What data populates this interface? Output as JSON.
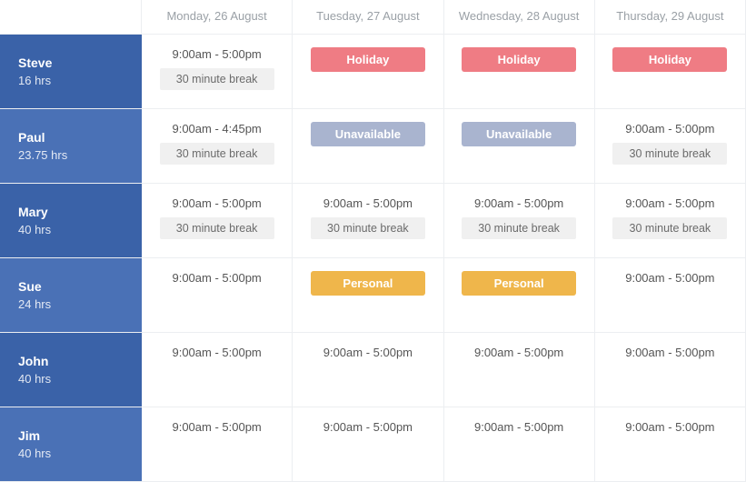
{
  "days": [
    "Monday, 26 August",
    "Tuesday, 27 August",
    "Wednesday, 28 August",
    "Thursday, 29 August"
  ],
  "status_labels": {
    "holiday": "Holiday",
    "unavailable": "Unavailable",
    "personal": "Personal"
  },
  "employees": [
    {
      "name": "Steve",
      "hours": "16 hrs",
      "shifts": [
        {
          "type": "shift",
          "time": "9:00am - 5:00pm",
          "break": "30 minute break"
        },
        {
          "type": "holiday"
        },
        {
          "type": "holiday"
        },
        {
          "type": "holiday"
        }
      ]
    },
    {
      "name": "Paul",
      "hours": "23.75 hrs",
      "shifts": [
        {
          "type": "shift",
          "time": "9:00am - 4:45pm",
          "break": "30 minute break"
        },
        {
          "type": "unavailable"
        },
        {
          "type": "unavailable"
        },
        {
          "type": "shift",
          "time": "9:00am - 5:00pm",
          "break": "30 minute break"
        }
      ]
    },
    {
      "name": "Mary",
      "hours": "40 hrs",
      "shifts": [
        {
          "type": "shift",
          "time": "9:00am - 5:00pm",
          "break": "30 minute break"
        },
        {
          "type": "shift",
          "time": "9:00am - 5:00pm",
          "break": "30 minute break"
        },
        {
          "type": "shift",
          "time": "9:00am - 5:00pm",
          "break": "30 minute break"
        },
        {
          "type": "shift",
          "time": "9:00am - 5:00pm",
          "break": "30 minute break"
        }
      ]
    },
    {
      "name": "Sue",
      "hours": "24 hrs",
      "shifts": [
        {
          "type": "shift",
          "time": "9:00am - 5:00pm"
        },
        {
          "type": "personal"
        },
        {
          "type": "personal"
        },
        {
          "type": "shift",
          "time": "9:00am - 5:00pm"
        }
      ]
    },
    {
      "name": "John",
      "hours": "40 hrs",
      "shifts": [
        {
          "type": "shift",
          "time": "9:00am - 5:00pm"
        },
        {
          "type": "shift",
          "time": "9:00am - 5:00pm"
        },
        {
          "type": "shift",
          "time": "9:00am - 5:00pm"
        },
        {
          "type": "shift",
          "time": "9:00am - 5:00pm"
        }
      ]
    },
    {
      "name": "Jim",
      "hours": "40 hrs",
      "shifts": [
        {
          "type": "shift",
          "time": "9:00am - 5:00pm"
        },
        {
          "type": "shift",
          "time": "9:00am - 5:00pm"
        },
        {
          "type": "shift",
          "time": "9:00am - 5:00pm"
        },
        {
          "type": "shift",
          "time": "9:00am - 5:00pm"
        }
      ]
    }
  ]
}
